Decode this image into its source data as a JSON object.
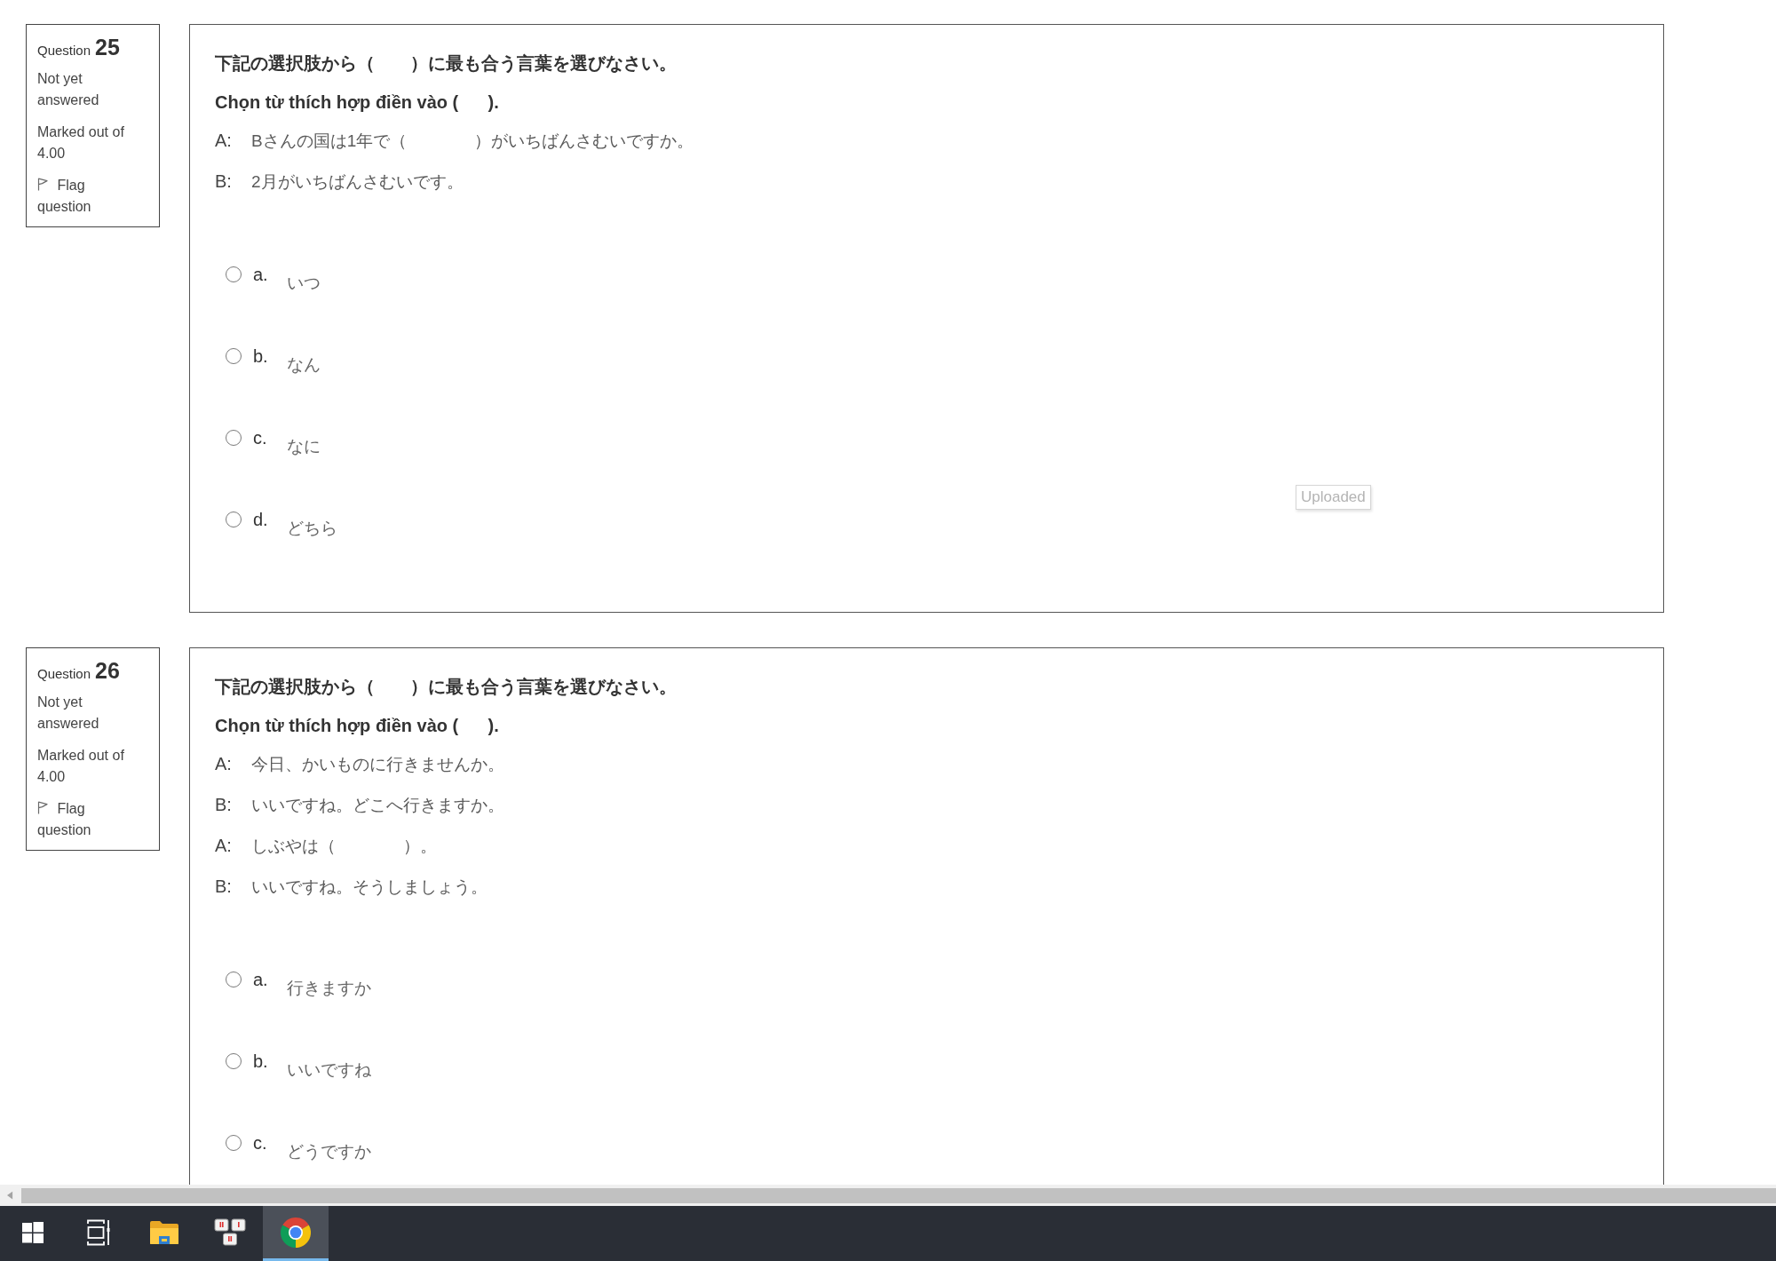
{
  "questions": [
    {
      "label": "Question",
      "number": "25",
      "status": "Not yet answered",
      "marks": "Marked out of 4.00",
      "flag": {
        "label": "Flag question",
        "flagged": false
      },
      "instruction": "下記の選択肢から（　　）に最も合う言葉を選びなさい。",
      "translation": "Chọn từ thích hợp điền vào (      ).",
      "dialogue": [
        {
          "speaker": "A:",
          "line": "Bさんの国は1年で（　　　　）がいちばんさむいですか。"
        },
        {
          "speaker": "B:",
          "line": "2月がいちばんさむいです。"
        }
      ],
      "options": [
        {
          "letter": "a.",
          "text": "いつ",
          "selected": false
        },
        {
          "letter": "b.",
          "text": "なん",
          "selected": false
        },
        {
          "letter": "c.",
          "text": "なに",
          "selected": false
        },
        {
          "letter": "d.",
          "text": "どちら",
          "selected": false
        }
      ]
    },
    {
      "label": "Question",
      "number": "26",
      "status": "Not yet answered",
      "marks": "Marked out of 4.00",
      "flag": {
        "label": "Flag question",
        "flagged": false
      },
      "instruction": "下記の選択肢から（　　）に最も合う言葉を選びなさい。",
      "translation": "Chọn từ thích hợp điền vào (      ).",
      "dialogue": [
        {
          "speaker": "A:",
          "line": "今日、かいものに行きませんか。"
        },
        {
          "speaker": "B:",
          "line": "いいですね。どこへ行きますか。"
        },
        {
          "speaker": "A:",
          "line": "しぶやは（　　　　）。"
        },
        {
          "speaker": "B:",
          "line": "いいですね。そうしましょう。"
        }
      ],
      "options": [
        {
          "letter": "a.",
          "text": "行きますか",
          "selected": false
        },
        {
          "letter": "b.",
          "text": "いいですね",
          "selected": false
        },
        {
          "letter": "c.",
          "text": "どうですか",
          "selected": false
        }
      ]
    }
  ],
  "tooltip": "Uploaded",
  "taskbar": {
    "items": [
      {
        "kind": "start",
        "selected": false
      },
      {
        "kind": "task_view",
        "selected": false
      },
      {
        "kind": "folder",
        "selected": false
      },
      {
        "kind": "keyboard",
        "selected": false
      },
      {
        "kind": "browser",
        "selected": true
      }
    ]
  }
}
